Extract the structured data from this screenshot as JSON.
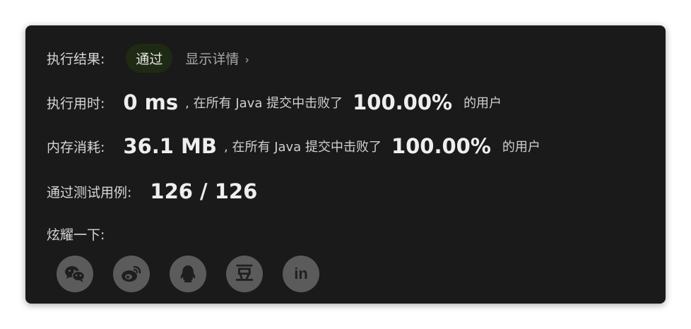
{
  "result": {
    "label": "执行结果:",
    "badge": "通过",
    "details_link": "显示详情",
    "details_chevron": "›",
    "colors": {
      "badge_bg": "#1f2a14",
      "panel_bg": "#1a1a1a"
    }
  },
  "runtime": {
    "label": "执行用时:",
    "value": "0 ms",
    "middle_text": ", 在所有 Java 提交中击败了",
    "percent": "100.00%",
    "suffix": "的用户"
  },
  "memory": {
    "label": "内存消耗:",
    "value": "36.1 MB",
    "middle_text": ", 在所有 Java 提交中击败了",
    "percent": "100.00%",
    "suffix": "的用户"
  },
  "tests": {
    "label": "通过测试用例:",
    "value": "126 / 126"
  },
  "share": {
    "label": "炫耀一下:",
    "buttons": [
      {
        "icon": "wechat-icon"
      },
      {
        "icon": "weibo-icon"
      },
      {
        "icon": "qq-icon"
      },
      {
        "icon": "douban-icon",
        "glyph": "豆"
      },
      {
        "icon": "linkedin-icon",
        "glyph": "in"
      }
    ]
  }
}
